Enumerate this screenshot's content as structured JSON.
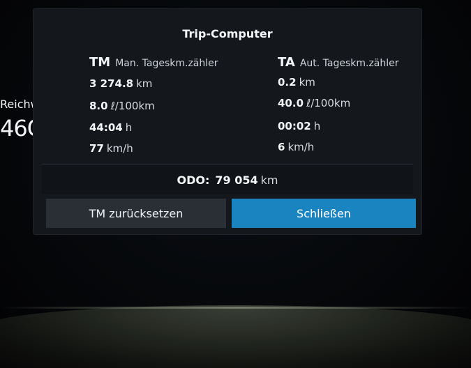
{
  "background": {
    "range_label": "Reichw",
    "range_value": "46C"
  },
  "dialog": {
    "title": "Trip-Computer",
    "tm": {
      "abbr": "TM",
      "name": "Man. Tageskm.zähler",
      "distance": {
        "value": "3 274.8",
        "unit": "km"
      },
      "consumption": {
        "value": "8.0",
        "unit": "ℓ/100km"
      },
      "time": {
        "value": "44:04",
        "unit": "h"
      },
      "speed": {
        "value": "77",
        "unit": "km/h"
      }
    },
    "ta": {
      "abbr": "TA",
      "name": "Aut. Tageskm.zähler",
      "distance": {
        "value": "0.2",
        "unit": "km"
      },
      "consumption": {
        "value": "40.0",
        "unit": "ℓ/100km"
      },
      "time": {
        "value": "00:02",
        "unit": "h"
      },
      "speed": {
        "value": "6",
        "unit": "km/h"
      }
    },
    "odo": {
      "label": "ODO:",
      "value": "79 054",
      "unit": "km"
    },
    "buttons": {
      "reset_label": "TM zurücksetzen",
      "close_label": "Schließen"
    }
  },
  "colors": {
    "dialog_bg": "#14171c",
    "accent": "#1a84c0",
    "secondary_button": "#2a2f36"
  }
}
